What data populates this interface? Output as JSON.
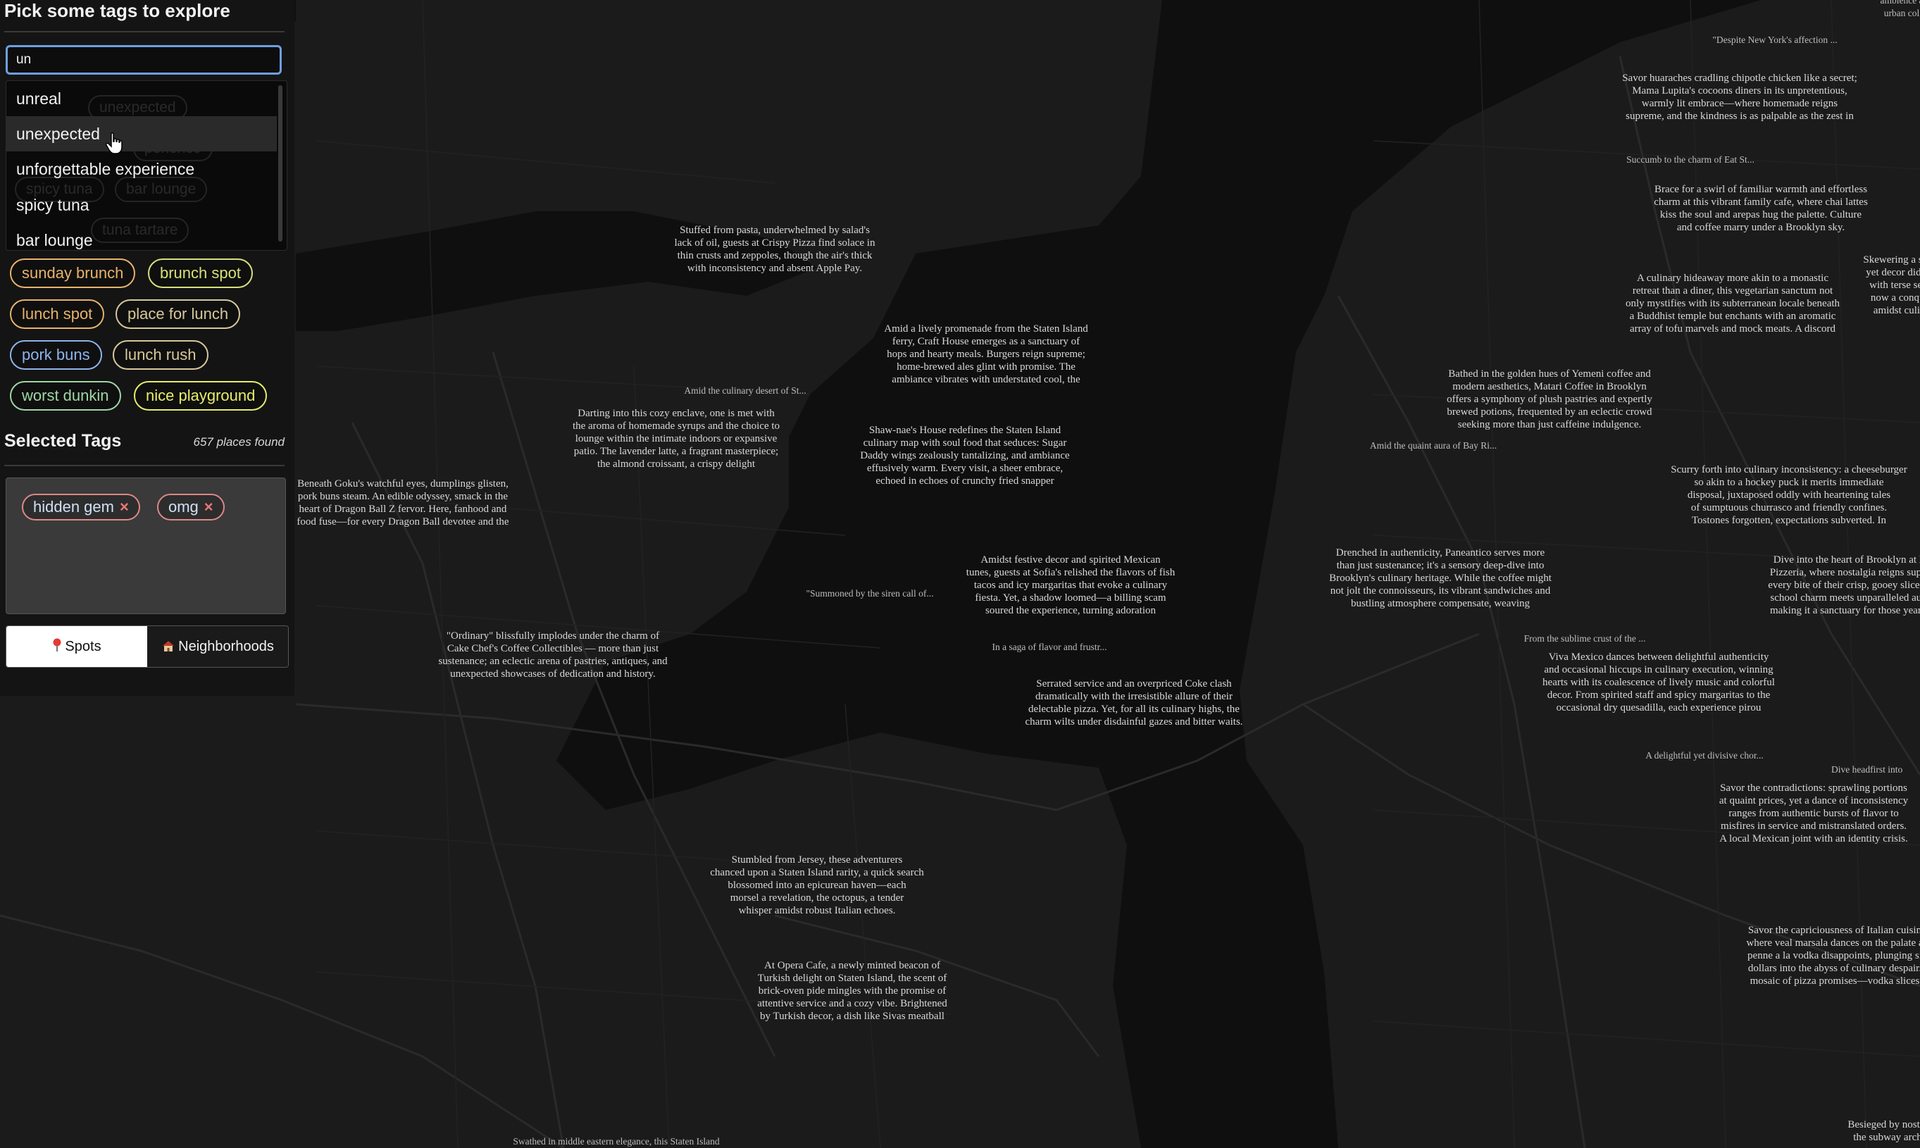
{
  "sidebar": {
    "title": "Pick some tags to explore",
    "search": {
      "value": "un"
    },
    "dropdown": {
      "options": [
        "unreal",
        "unexpected",
        "unforgettable experience",
        "spicy tuna",
        "bar lounge"
      ],
      "hovered_index": 1,
      "ghost_tags": [
        "unexpected",
        "perience",
        "spicy tuna",
        "bar lounge",
        "tuna tartare"
      ]
    },
    "suggested_tags": [
      {
        "label": "sunday brunch",
        "color": "#e8b36a"
      },
      {
        "label": "brunch spot",
        "color": "#d8e07a"
      },
      {
        "label": "lunch spot",
        "color": "#e8b36a"
      },
      {
        "label": "place for lunch",
        "color": "#d7c89a"
      },
      {
        "label": "pork buns",
        "color": "#8db4ea"
      },
      {
        "label": "lunch rush",
        "color": "#d7c89a"
      },
      {
        "label": "worst dunkin",
        "color": "#9ed7a4"
      },
      {
        "label": "nice playground",
        "color": "#e8ec6a"
      }
    ],
    "selected_title": "Selected Tags",
    "places_found": "657 places found",
    "selected_tags": [
      {
        "label": "hidden gem",
        "remove": "×"
      },
      {
        "label": "omg",
        "remove": "×"
      }
    ],
    "view_toggle": {
      "spots_label": "Spots",
      "neighborhoods_label": "Neighborhoods",
      "active": "Spots"
    }
  },
  "map": {
    "colors": {
      "land": "#1d1d1d",
      "water": "#101010",
      "roads": "#262626",
      "labels": "#d8d8d8"
    },
    "labels": [
      "ambience a\nurban col",
      "\"Despite New York's affection ...",
      "Savor huaraches cradling chipotle chicken like a secret;\nMama Lupita's cocoons diners in its unpretentious,\nwarmly lit embrace—where homemade reigns\nsupreme, and the kindness is as palpable as the zest in",
      "Succumb to the charm of Eat St...",
      "Brace for a swirl of familiar warmth and effortless\ncharm at this vibrant family cafe, where chai lattes\nkiss the soul and arepas hug the palette. Culture\nand coffee marry under a Brooklyn sky.",
      "Skewering a steak\nyet decor didn't f\nwith terse servi\nnow a conquer\namidst culina",
      "Stuffed from pasta, underwhelmed by salad's\nlack of oil, guests at Crispy Pizza find solace in\nthin crusts and zeppoles, though the air's thick\nwith inconsistency and absent Apple Pay.",
      "A culinary hideaway more akin to a monastic\nretreat than a diner, this vegetarian sanctum not\nonly mystifies with its subterranean locale beneath\na Buddhist temple but enchants with an aromatic\narray of tofu marvels and mock meats. A discord",
      "Amid a lively promenade from the Staten Island\nferry, Craft House emerges as a sanctuary of\nhops and hearty meals. Burgers reign supreme;\nhome-brewed ales glint with promise. The\nambiance vibrates with understated cool, the",
      "Bathed in the golden hues of Yemeni coffee and\nmodern aesthetics, Matari Coffee in Brooklyn\noffers a symphony of plush pastries and expertly\nbrewed potions, frequented by an eclectic crowd\nseeking more than just caffeine indulgence.",
      "Amid the culinary desert of St...",
      "Darting into this cozy enclave, one is met with\nthe aroma of homemade syrups and the choice to\nlounge within the intimate indoors or expansive\npatio. The lavender latte, a fragrant masterpiece;\nthe almond croissant, a crispy delight",
      "Shaw-nae's House redefines the Staten Island\nculinary map with soul food that seduces: Sugar\nDaddy wings zealously tantalizing, and ambiance\neffusively warm. Every visit, a sheer embrace,\nechoed in echoes of crunchy fried snapper",
      "Amid the quaint aura of Bay Ri...",
      "Scurry forth into culinary inconsistency: a cheeseburger\nso akin to a hockey puck it merits immediate\ndisposal, juxtaposed oddly with heartening tales\nof sumptuous churrasco and friendly confines.\nTostones forgotten, expectations subverted. In",
      "Beneath Goku's watchful eyes, dumplings glisten,\npork buns steam. An edible odyssey, smack in the\nheart of Dragon Ball Z fervor. Here, fanhood and\nfood fuse—for every Dragon Ball devotee and the",
      "Drenched in authenticity, Paneantico serves more\nthan just sustenance; it's a sensory deep-dive into\nBrooklyn's culinary heritage. While the coffee might\nnot jolt the connoisseurs, its vibrant sandwiches and\nbustling atmosphere compensate, weaving",
      "Dive into the heart of Brooklyn at Da\nPizzeria, where nostalgia reigns supren\nevery bite of their crisp, gooey slices. H\nschool charm meets unparalleled authe\nmaking it a sanctuary for those yearnin",
      "Amidst festive decor and spirited Mexican\ntunes, guests at Sofia's relished the flavors of fish\ntacos and icy margaritas that evoke a culinary\nfiesta. Yet, a shadow loomed—a billing scam\nsoured the experience, turning adoration",
      "\"Summoned by the siren call of...",
      "\"Ordinary\" blissfully implodes under the charm of\nCake Chef's Coffee Collectibles — more than just\nsustenance; an eclectic arena of pastries, antiques, and\nunexpected showcases of dedication and history.",
      "From the sublime crust of the ...",
      "In a saga of flavor and frustr...",
      "Viva Mexico dances between delightful authenticity\nand occasional hiccups in culinary execution, winning\nhearts with its coalescence of lively music and colorful\ndecor. From spirited staff and spicy margaritas to the\noccasional dry quesadilla, each experience pirou",
      "Serrated service and an overpriced Coke clash\ndramatically with the irresistible allure of their\ndelectable pizza. Yet, for all its culinary highs, the\ncharm wilts under disdainful gazes and bitter waits.",
      "A delightful yet divisive chor...",
      "Dive headfirst into",
      "Savor the contradictions: sprawling portions\nat quaint prices, yet a dance of inconsistency\nranges from authentic bursts of flavor to\nmisfires in service and mistranslated orders.\nA local Mexican joint with an identity crisis.",
      "Stumbled from Jersey, these adventurers\nchanced upon a Staten Island rarity, a quick search\nblossomed into an epicurean haven—each\nmorsel a revelation, the octopus, a tender\nwhisper amidst robust Italian echoes.",
      "Savor the capriciousness of Italian cuisin\nwhere veal marsala dances on the palate a\npenne a la vodka disappoints, plunging si\ndollars into the abyss of culinary despair.\nmosaic of pizza promises—vodka slices",
      "At Opera Cafe, a newly minted beacon of\nTurkish delight on Staten Island, the scent of\nbrick-oven pide mingles with the promise of\nattentive service and a cozy vibe. Brightened\nby Turkish decor, a dish like Sivas meatball",
      "Besieged by nostal\nthe subway arch",
      "Swathed in middle eastern elegance, this Staten Island"
    ]
  }
}
